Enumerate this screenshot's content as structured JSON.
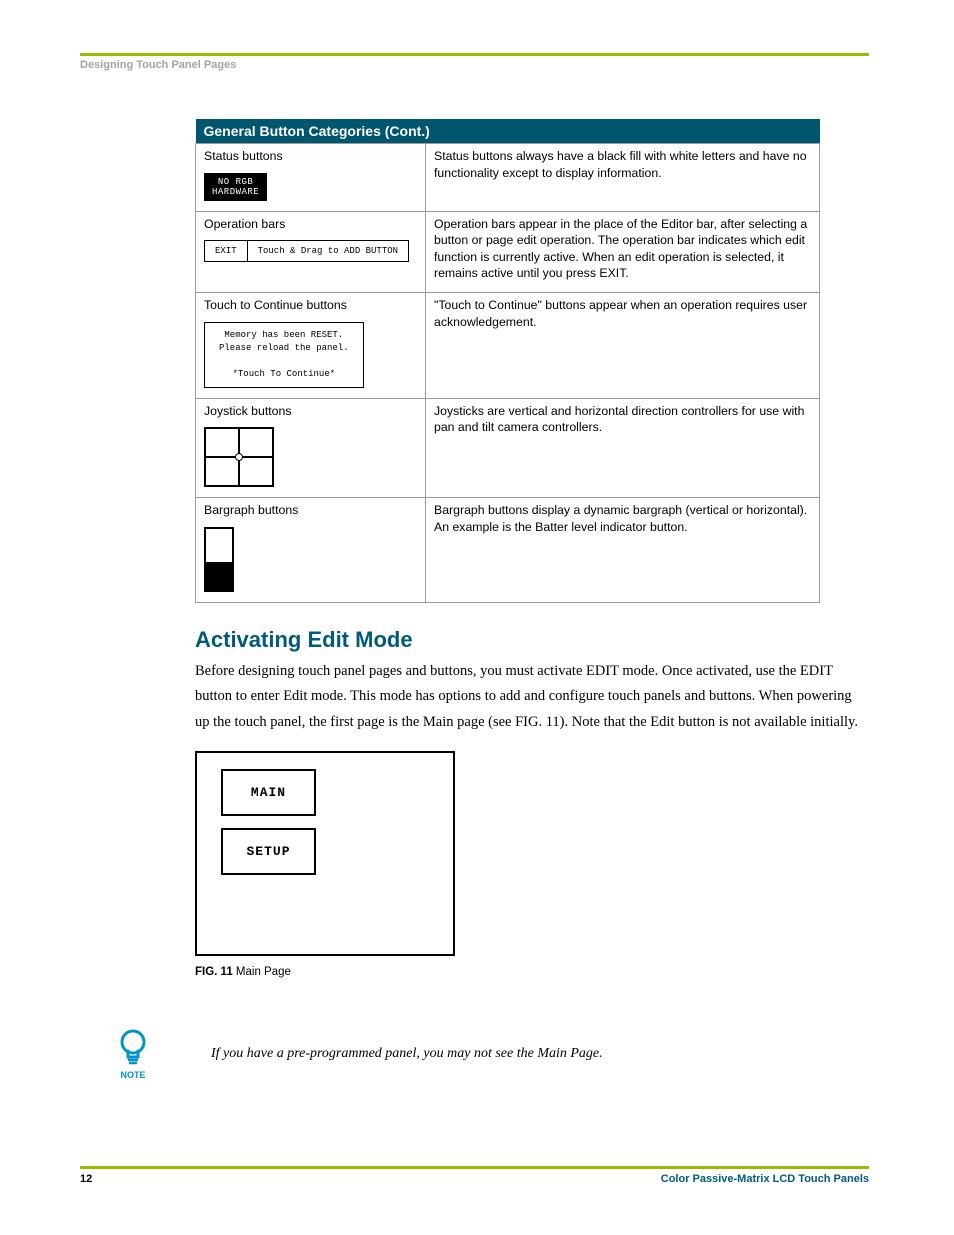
{
  "header": {
    "section_name": "Designing Touch Panel Pages"
  },
  "table": {
    "title": "General Button Categories (Cont.)",
    "rows": [
      {
        "label": "Status buttons",
        "desc": "Status buttons always have a black fill with white letters and have no functionality except to display information.",
        "chip_line1": "NO RGB",
        "chip_line2": "HARDWARE"
      },
      {
        "label": "Operation bars",
        "desc": "Operation bars appear in the place of the Editor bar, after selecting a button or page edit operation. The operation bar indicates which edit function is currently active. When an edit operation is selected, it remains active until you press EXIT.",
        "exit": "EXIT",
        "msg": "Touch & Drag to ADD BUTTON"
      },
      {
        "label": "Touch to Continue buttons",
        "desc": "\"Touch to Continue\" buttons appear when an operation requires user acknowledgement.",
        "l1": "Memory has been RESET.",
        "l2": "Please reload the panel.",
        "l3": "*Touch To Continue*"
      },
      {
        "label": "Joystick buttons",
        "desc": "Joysticks are vertical and horizontal direction controllers for use with pan and tilt camera controllers."
      },
      {
        "label": "Bargraph buttons",
        "desc": "Bargraph buttons display a dynamic bargraph (vertical or horizontal). An example is the Batter level indicator button."
      }
    ]
  },
  "section": {
    "heading": "Activating Edit Mode",
    "para": "Before designing touch panel pages and buttons, you must activate EDIT mode. Once activated, use the EDIT button to enter Edit mode. This mode has options to add and configure touch panels and buttons. When powering up the touch panel, the first page is the Main page (see FIG. 11). Note that the Edit button is not available initially."
  },
  "figure": {
    "btn_main": "MAIN",
    "btn_setup": "SETUP",
    "caption_bold": "FIG. 11",
    "caption_rest": "  Main Page"
  },
  "note": {
    "label": "NOTE",
    "text": "If you have a pre-programmed panel, you may not see the Main Page."
  },
  "footer": {
    "page": "12",
    "title": "Color Passive-Matrix LCD Touch Panels"
  }
}
